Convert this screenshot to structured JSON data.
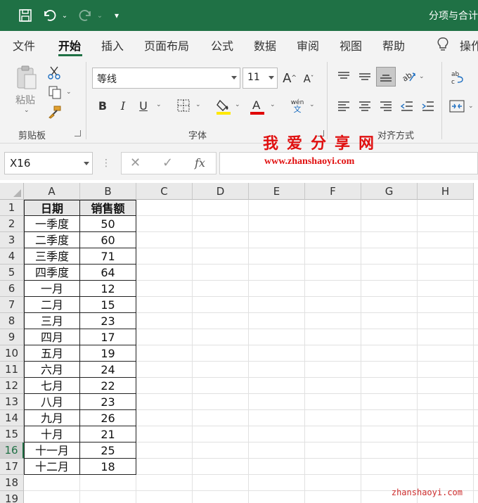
{
  "window": {
    "title": "分项与合计"
  },
  "tabs": [
    {
      "label": "文件",
      "active": false
    },
    {
      "label": "开始",
      "active": true
    },
    {
      "label": "插入",
      "active": false
    },
    {
      "label": "页面布局",
      "active": false
    },
    {
      "label": "公式",
      "active": false
    },
    {
      "label": "数据",
      "active": false
    },
    {
      "label": "审阅",
      "active": false
    },
    {
      "label": "视图",
      "active": false
    },
    {
      "label": "帮助",
      "active": false
    }
  ],
  "tell_me": {
    "label": "操作"
  },
  "ribbon": {
    "clipboard": {
      "label": "剪贴板",
      "paste_label": "粘贴"
    },
    "font": {
      "label": "字体",
      "font_name": "等线",
      "font_size": "11",
      "phonetic_top": "wén",
      "phonetic_bottom": "文"
    },
    "alignment": {
      "label": "对齐方式"
    },
    "accent_color": "#1f7145",
    "fill_color": "#ffe800",
    "font_color": "#e00000"
  },
  "formula_bar": {
    "name_box": "X16",
    "fx": "fx"
  },
  "watermark": {
    "title": "我爱分享网",
    "url": "www.zhanshaoyi.com"
  },
  "sheet": {
    "columns": [
      "A",
      "B",
      "C",
      "D",
      "E",
      "F",
      "G",
      "H"
    ],
    "rows": [
      "1",
      "2",
      "3",
      "4",
      "5",
      "6",
      "7",
      "8",
      "9",
      "10",
      "11",
      "12",
      "13",
      "14",
      "15",
      "16",
      "17",
      "18",
      "19"
    ],
    "selected_row": "16",
    "header": [
      "日期",
      "销售额"
    ],
    "data": [
      [
        "一季度",
        "50"
      ],
      [
        "二季度",
        "60"
      ],
      [
        "三季度",
        "71"
      ],
      [
        "四季度",
        "64"
      ],
      [
        "一月",
        "12"
      ],
      [
        "二月",
        "15"
      ],
      [
        "三月",
        "23"
      ],
      [
        "四月",
        "17"
      ],
      [
        "五月",
        "19"
      ],
      [
        "六月",
        "24"
      ],
      [
        "七月",
        "22"
      ],
      [
        "八月",
        "23"
      ],
      [
        "九月",
        "26"
      ],
      [
        "十月",
        "21"
      ],
      [
        "十一月",
        "25"
      ],
      [
        "十二月",
        "18"
      ]
    ]
  },
  "credit": "zhanshaoyi.com"
}
